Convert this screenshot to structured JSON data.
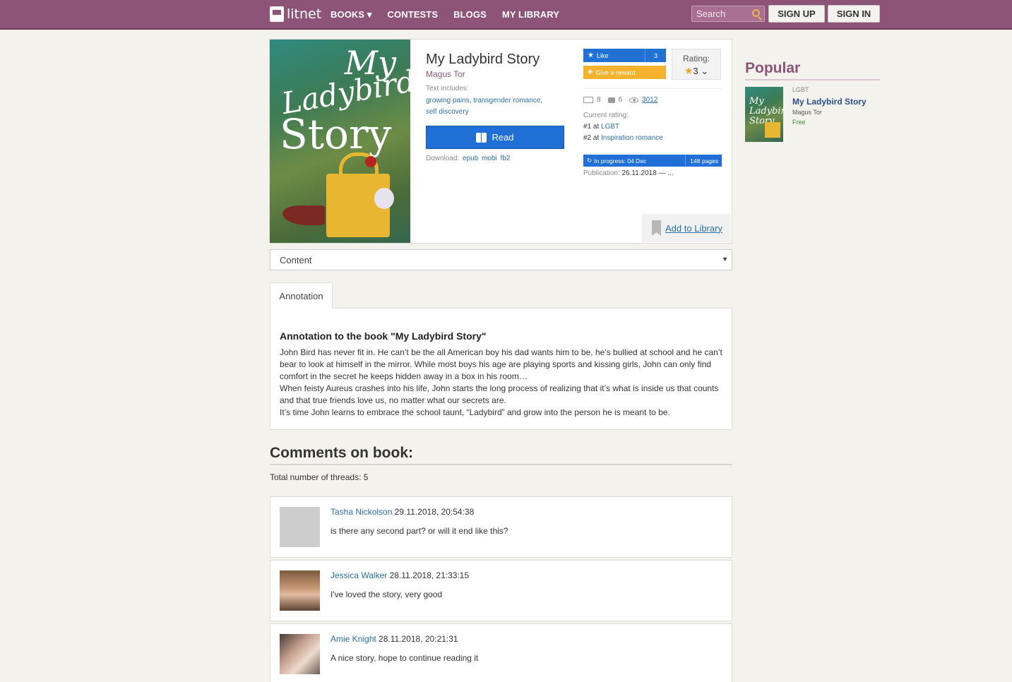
{
  "nav": {
    "logo": "litnet",
    "items": [
      "BOOKS",
      "CONTESTS",
      "BLOGS",
      "MY LIBRARY"
    ],
    "books_caret": "▾",
    "search_placeholder": "Search",
    "signup": "SIGN UP",
    "signin": "SIGN IN"
  },
  "book": {
    "cover_lines": [
      "My",
      "Ladybird",
      "Story"
    ],
    "title": "My Ladybird Story",
    "author": "Magus Tor",
    "text_includes_label": "Text includes:",
    "tags": [
      "growing pains",
      "transgender romance",
      "self discovery"
    ],
    "read_label": "Read",
    "download_label": "Download:",
    "download_formats": [
      "epub",
      "mobi",
      "fb2"
    ],
    "like_label": "Like",
    "like_count": "3",
    "reward_label": "Give a reward",
    "rating_label": "Rating:",
    "rating_value": "3",
    "stats": {
      "libraries": "8",
      "comments": "6",
      "views": "3012"
    },
    "current_rating_label": "Current rating:",
    "ranks": [
      {
        "prefix": "#1 at",
        "category": "LGBT"
      },
      {
        "prefix": "#2 at",
        "category": "Inspiration romance"
      }
    ],
    "progress_label": "In progress: 04 Dec",
    "pages": "148 pages",
    "publication_label": "Publication:",
    "publication_value": "26.11.2018 — ...",
    "add_to_library": "Add to Library"
  },
  "content_select": {
    "value": "Content"
  },
  "annotation": {
    "tab_label": "Annotation",
    "title": "Annotation to the book \"My Ladybird Story\"",
    "paragraphs": [
      "John Bird has never fit in. He can’t be the all American boy his dad wants him to be, he’s bullied at school and he can’t bear to look at himself in the mirror. While most boys his age are playing sports and kissing girls, John can only find comfort in the secret he keeps hidden away in a box in his room…",
      "When feisty Aureus crashes into his life, John starts the long process of realizing that it’s what is inside us that counts and that true friends love us, no matter what our secrets are.",
      "It’s time John learns to embrace the school taunt, “Ladybird” and grow into the person he is meant to be."
    ]
  },
  "comments": {
    "title": "Comments on book:",
    "threads_count": "Total number of threads: 5",
    "items": [
      {
        "author": "Tasha Nickolson",
        "date": "29.11.2018, 20:54:38",
        "text": "is there any second part? or will it end like this?"
      },
      {
        "author": "Jessica Walker",
        "date": "28.11.2018, 21:33:15",
        "text": "I've loved the story, very good"
      },
      {
        "author": "Amie Knight",
        "date": "28.11.2018, 20:21:31",
        "text": "A nice story, hope to continue reading it"
      }
    ]
  },
  "popular": {
    "title": "Popular",
    "item": {
      "genre": "LGBT",
      "title": "My Ladybird Story",
      "author": "Magus Tor",
      "price": "Free",
      "cover_lines": [
        "My",
        "Ladybird",
        "Story"
      ]
    }
  }
}
